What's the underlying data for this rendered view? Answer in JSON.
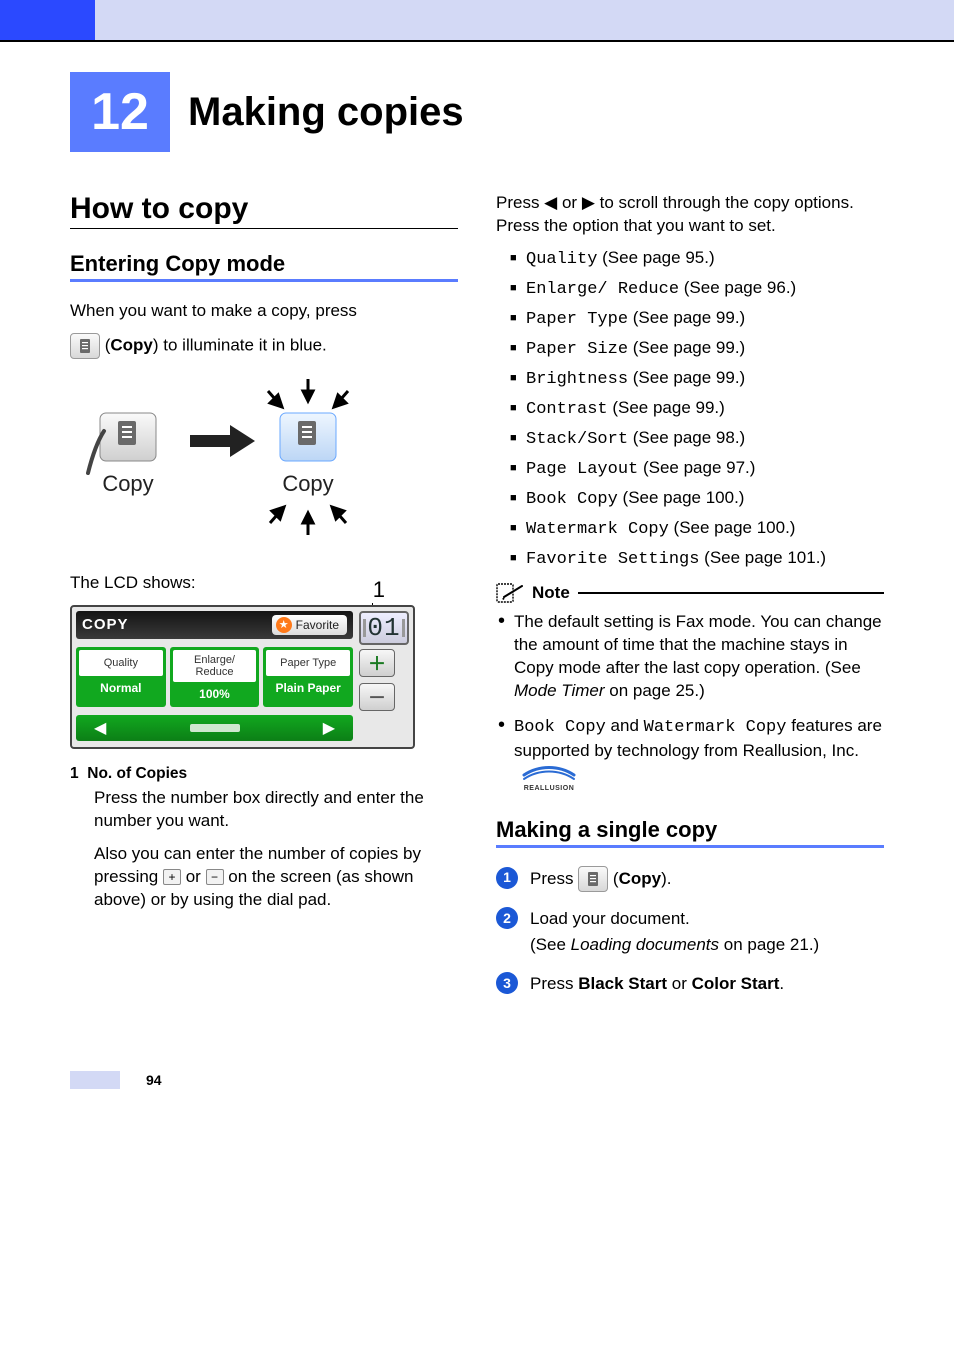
{
  "chapter": {
    "number": "12",
    "title": "Making copies"
  },
  "left": {
    "section": "How to copy",
    "subsection": "Entering Copy mode",
    "intro_1": "When you want to make a copy, press",
    "intro_2a": " (",
    "intro_2b": "Copy",
    "intro_2c": ") to illuminate it in blue.",
    "illus": {
      "copy_label": "Copy"
    },
    "lcd_intro": "The LCD shows:",
    "lcd": {
      "title": "COPY",
      "favorite": "Favorite",
      "counter": "01",
      "cells": [
        {
          "label": "Quality",
          "value": "Normal"
        },
        {
          "label": "Enlarge/\nReduce",
          "value": "100%"
        },
        {
          "label": "Paper Type",
          "value": "Plain Paper"
        }
      ],
      "callout_number": "1"
    },
    "def_head_num": "1",
    "def_head_title": "No. of Copies",
    "def_p1": "Press the number box directly and enter the number you want.",
    "def_p2a": "Also you can enter the number of copies by pressing ",
    "def_p2b": " or ",
    "def_p2c": " on the screen (as shown above) or by using the dial pad."
  },
  "right": {
    "scroll_intro": "Press ◀ or ▶ to scroll through the copy options. Press the option that you want to set.",
    "options": [
      {
        "code": "Quality",
        "ref": " (See page 95.)"
      },
      {
        "code": "Enlarge/ Reduce",
        "ref": " (See page 96.)"
      },
      {
        "code": "Paper Type",
        "ref": " (See page 99.)"
      },
      {
        "code": "Paper Size",
        "ref": " (See page 99.)"
      },
      {
        "code": "Brightness",
        "ref": " (See page 99.)"
      },
      {
        "code": "Contrast",
        "ref": " (See page 99.)"
      },
      {
        "code": "Stack/Sort",
        "ref": " (See page 98.)"
      },
      {
        "code": "Page Layout",
        "ref": " (See page 97.)"
      },
      {
        "code": "Book Copy",
        "ref": " (See page 100.)"
      },
      {
        "code": "Watermark Copy",
        "ref": " (See page 100.)"
      },
      {
        "code": "Favorite Settings",
        "ref": " (See page 101.)"
      }
    ],
    "note_title": "Note",
    "note1_a": "The default setting is Fax mode. You can change the amount of time that the machine stays in Copy mode after the last copy operation. (See ",
    "note1_b": "Mode Timer",
    "note1_c": " on page 25.)",
    "note2_a": "Book Copy",
    "note2_b": " and ",
    "note2_c": "Watermark Copy",
    "note2_d": " features are supported by technology from Reallusion, Inc. ",
    "reallusion_label": "REALLUSION",
    "single": {
      "heading": "Making a single copy",
      "steps": {
        "s1_a": "Press ",
        "s1_b": " (",
        "s1_c": "Copy",
        "s1_d": ").",
        "s2_a": "Load your document.",
        "s2_b": "(See ",
        "s2_c": "Loading documents",
        "s2_d": " on page 21.)",
        "s3_a": "Press ",
        "s3_b": "Black Start",
        "s3_c": " or ",
        "s3_d": "Color Start",
        "s3_e": "."
      }
    }
  },
  "page_number": "94"
}
